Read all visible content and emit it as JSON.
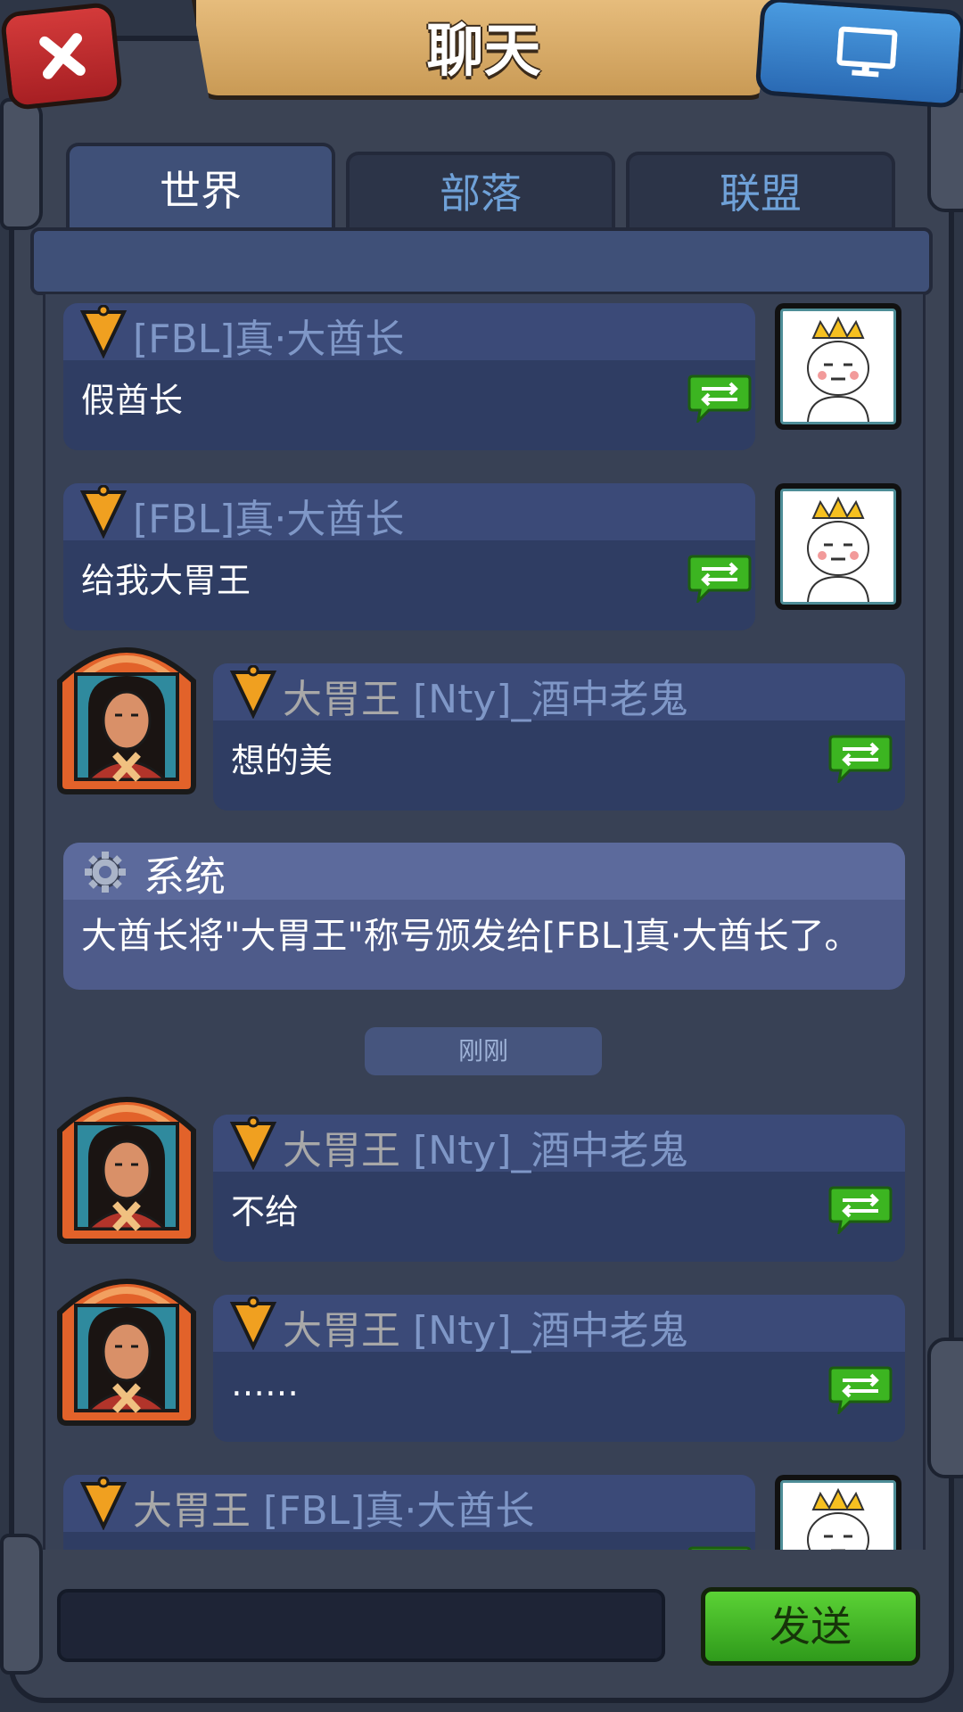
{
  "header": {
    "title": "聊天",
    "close_icon": "close-icon",
    "screen_icon": "monitor-icon"
  },
  "tabs": [
    {
      "label": "世界",
      "active": true
    },
    {
      "label": "部落",
      "active": false
    },
    {
      "label": "联盟",
      "active": false
    }
  ],
  "messages": [
    {
      "side": "right",
      "name": "[FBL]真·大酋长",
      "title_prefix": "",
      "text": "假酋长"
    },
    {
      "side": "right",
      "name": "[FBL]真·大酋长",
      "title_prefix": "",
      "text": "给我大胃王"
    },
    {
      "side": "left",
      "name": "[Nty]_酒中老鬼",
      "title_prefix": "大胃王 ",
      "text": "想的美"
    },
    {
      "side": "left",
      "name": "[Nty]_酒中老鬼",
      "title_prefix": "大胃王 ",
      "text": "不给"
    },
    {
      "side": "left",
      "name": "[Nty]_酒中老鬼",
      "title_prefix": "大胃王 ",
      "text": "……"
    },
    {
      "side": "right",
      "name": "[FBL]真·大酋长",
      "title_prefix": "大胃王 ",
      "text": ""
    }
  ],
  "system_message": {
    "label": "系统",
    "text": "大酋长将\"大胃王\"称号颁发给[FBL]真·大酋长了。"
  },
  "time_label": "刚刚",
  "input": {
    "value": "",
    "placeholder": ""
  },
  "send_label": "发送",
  "colors": {
    "accent_green": "#3cb521",
    "badge_orange": "#f0a020",
    "bubble": "#2f3d63"
  }
}
